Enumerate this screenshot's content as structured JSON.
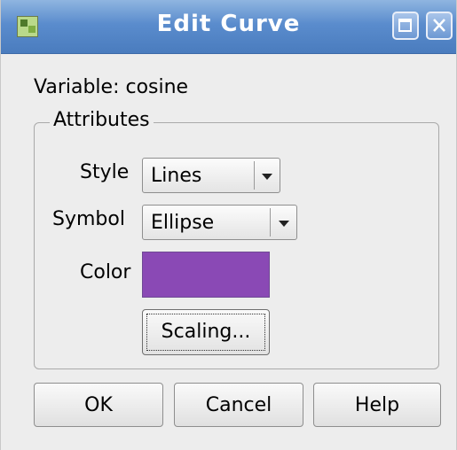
{
  "window": {
    "title": "Edit Curve",
    "icon": "app-icon",
    "maximize_icon": "maximize-icon",
    "close_icon": "close-icon"
  },
  "variable": {
    "label": "Variable: cosine"
  },
  "attributes": {
    "legend": "Attributes",
    "style": {
      "label": "Style",
      "value": "Lines"
    },
    "symbol": {
      "label": "Symbol",
      "value": "Ellipse"
    },
    "color": {
      "label": "Color",
      "value": "#8a49b5"
    },
    "scaling_button": "Scaling..."
  },
  "buttons": {
    "ok": "OK",
    "cancel": "Cancel",
    "help": "Help"
  },
  "colors": {
    "titlebar": "#5a8ccd",
    "swatch": "#8a49b5"
  }
}
